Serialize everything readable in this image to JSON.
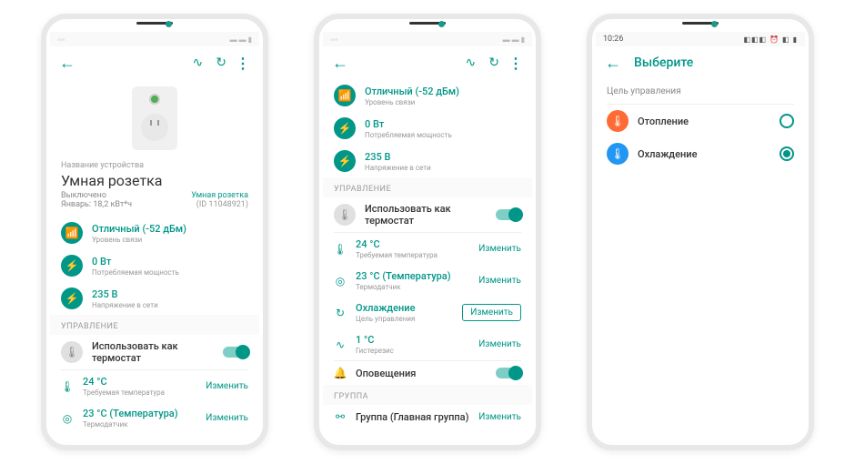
{
  "phone1": {
    "device_label": "Название устройства",
    "device_name": "Умная розетка",
    "state": "Выключено",
    "consumption": "Январь: 18,2 кВт*ч",
    "model": "Умная розетка",
    "device_id": "(ID 11048921)",
    "signal": {
      "title": "Отличный (-52 дБм)",
      "sub": "Уровень связи"
    },
    "power": {
      "title": "0 Вт",
      "sub": "Потребляемая мощность"
    },
    "voltage": {
      "title": "235 В",
      "sub": "Напряжение в сети"
    },
    "section_control": "УПРАВЛЕНИЕ",
    "thermostat": "Использовать как термостат",
    "target_temp": {
      "title": "24 °C",
      "sub": "Требуемая температура"
    },
    "sensor": {
      "title": "23 °С (Температура)",
      "sub": "Термодатчик"
    },
    "change": "Изменить"
  },
  "phone2": {
    "signal": {
      "title": "Отличный (-52 дБм)",
      "sub": "Уровень связи"
    },
    "power": {
      "title": "0 Вт",
      "sub": "Потребляемая мощность"
    },
    "voltage": {
      "title": "235 В",
      "sub": "Напряжение в сети"
    },
    "section_control": "УПРАВЛЕНИЕ",
    "thermostat": "Использовать как термостат",
    "target_temp": {
      "title": "24 °C",
      "sub": "Требуемая температура"
    },
    "sensor": {
      "title": "23 °С (Температура)",
      "sub": "Термодатчик"
    },
    "goal": {
      "title": "Охлаждение",
      "sub": "Цель управления"
    },
    "hysteresis": {
      "title": "1 °C",
      "sub": "Гистерезис"
    },
    "notifications": "Оповещения",
    "section_group": "ГРУППА",
    "group": "Группа (Главная группа)",
    "change": "Изменить"
  },
  "phone3": {
    "time": "10:26",
    "title": "Выберите",
    "subtitle": "Цель управления",
    "heating": "Отопление",
    "cooling": "Охлаждение"
  }
}
